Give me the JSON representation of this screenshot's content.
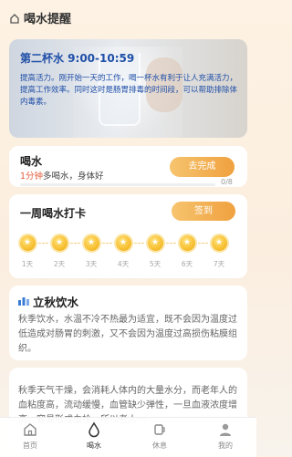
{
  "header": {
    "title": "喝水提醒"
  },
  "banner": {
    "title": "第二杯水 9:00-10:59",
    "description": "提高活力。刚开始一天的工作，喝一杯水有利于让人充满活力，提高工作效率。同时这时是肠胃排毒的时间段，可以帮助排除体内毒素。"
  },
  "drink_card": {
    "title": "喝水",
    "subtitle_highlight": "1分钟",
    "subtitle_rest": "多喝水，身体好",
    "button_label": "去完成",
    "progress_text": "0/8",
    "progress_fraction": 0,
    "accent_color": "#f0a13f"
  },
  "checkin_card": {
    "title": "一周喝水打卡",
    "button_label": "签到",
    "coin_symbol": "★",
    "days": [
      "1天",
      "2天",
      "3天",
      "4天",
      "5天",
      "6天",
      "7天"
    ]
  },
  "article": {
    "title": "立秋饮水",
    "body": "秋季饮水，水温不冷不热最为适宜，既不会因为温度过低造成对肠胃的刺激，又不会因为温度过高损伤粘膜组织。"
  },
  "article2": {
    "body": "秋季天气干燥，会消耗人体内的大量水分，而老年人的血粘度高，流动缓慢，血管缺少弹性，一旦血液浓度增高，容易形成血栓，所以老人一"
  },
  "tabbar": {
    "items": [
      {
        "label": "首页",
        "icon": "home-icon",
        "active": false
      },
      {
        "label": "喝水",
        "icon": "water-drop-icon",
        "active": true
      },
      {
        "label": "休息",
        "icon": "cup-icon",
        "active": false
      },
      {
        "label": "我的",
        "icon": "person-icon",
        "active": false
      }
    ]
  }
}
